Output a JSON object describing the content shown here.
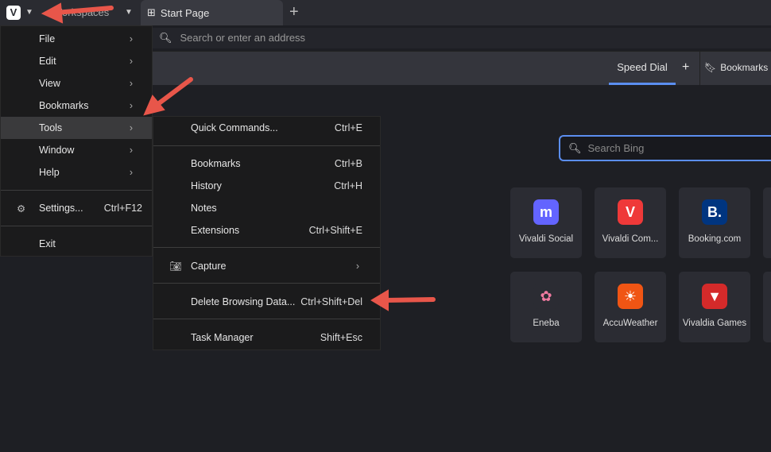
{
  "tabbar": {
    "workspaces_label": "Workspaces",
    "tab_title": "Start Page",
    "new_tab": "+"
  },
  "address": {
    "placeholder": "Search or enter an address"
  },
  "panel": {
    "speed_dial": "Speed Dial",
    "add": "+",
    "bookmarks": "Bookmarks"
  },
  "search": {
    "placeholder": "Search Bing"
  },
  "speed_dial": [
    {
      "label": "Vivaldi Social",
      "icon": "mastodon-icon",
      "color": "#6364ff",
      "glyph": "m"
    },
    {
      "label": "Vivaldi Com...",
      "icon": "vivaldi-icon",
      "color": "#ef3939",
      "glyph": "V"
    },
    {
      "label": "Booking.com",
      "icon": "booking-icon",
      "color": "#003580",
      "glyph": "B."
    },
    {
      "label": "Eneba",
      "icon": "eneba-icon",
      "color": "#2b2c33",
      "glyph": "✿"
    },
    {
      "label": "AccuWeather",
      "icon": "sun-icon",
      "color": "#f05514",
      "glyph": "☀"
    },
    {
      "label": "Vivaldia Games",
      "icon": "vivaldia-icon",
      "color": "#d42a2a",
      "glyph": "▼"
    }
  ],
  "main_menu": {
    "items": [
      {
        "label": "File",
        "has_submenu": true
      },
      {
        "label": "Edit",
        "has_submenu": true
      },
      {
        "label": "View",
        "has_submenu": true
      },
      {
        "label": "Bookmarks",
        "has_submenu": true
      },
      {
        "label": "Tools",
        "has_submenu": true,
        "highlighted": true
      },
      {
        "label": "Window",
        "has_submenu": true
      },
      {
        "label": "Help",
        "has_submenu": true
      }
    ],
    "settings": {
      "label": "Settings...",
      "shortcut": "Ctrl+F12"
    },
    "exit": {
      "label": "Exit"
    }
  },
  "tools_menu": {
    "items": [
      {
        "label": "Quick Commands...",
        "shortcut": "Ctrl+E"
      },
      {
        "label": "Bookmarks",
        "shortcut": "Ctrl+B"
      },
      {
        "label": "History",
        "shortcut": "Ctrl+H"
      },
      {
        "label": "Notes",
        "shortcut": ""
      },
      {
        "label": "Extensions",
        "shortcut": "Ctrl+Shift+E"
      },
      {
        "label": "Capture",
        "shortcut": "",
        "has_submenu": true
      },
      {
        "label": "Delete Browsing Data...",
        "shortcut": "Ctrl+Shift+Del"
      },
      {
        "label": "Task Manager",
        "shortcut": "Shift+Esc"
      }
    ]
  },
  "colors": {
    "accent": "#5b8ef0",
    "annotation_arrow": "#e8564a"
  }
}
